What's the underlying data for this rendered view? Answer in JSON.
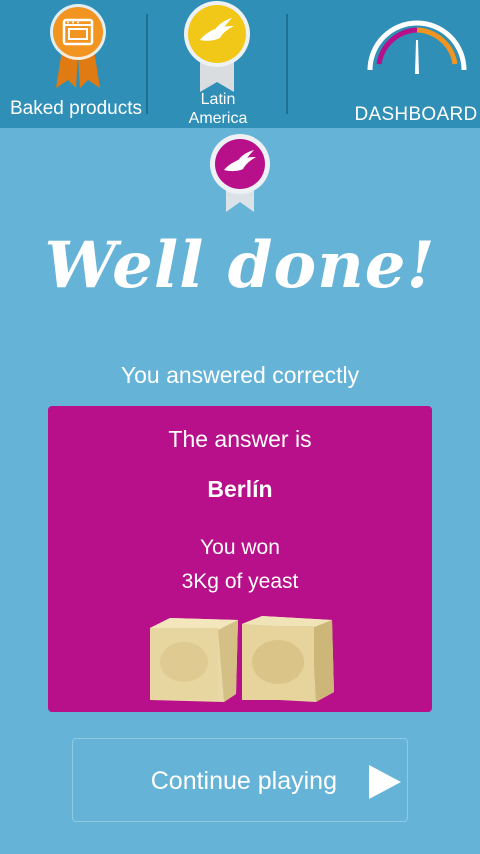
{
  "header": {
    "category": {
      "label": "Baked products",
      "icon": "oven-medal-icon"
    },
    "region": {
      "label_line1": "Latin",
      "label_line2": "America",
      "icon": "swift-gold-medal-icon"
    },
    "dashboard": {
      "label": "DASHBOARD",
      "icon": "gauge-icon"
    }
  },
  "result": {
    "medal_icon": "swift-purple-medal-icon",
    "title": "Well done!",
    "subtitle": "You answered correctly"
  },
  "card": {
    "answer_intro": "The answer is",
    "answer": "Berlín",
    "won": "You won",
    "prize": "3Kg of yeast",
    "image": "yeast-cubes"
  },
  "continue_button": {
    "label": "Continue playing",
    "icon": "play-icon"
  },
  "colors": {
    "background": "#66b3d8",
    "header": "#2f8fb7",
    "card": "#b8108a",
    "medal_orange": "#f19420",
    "medal_gold": "#f2c818",
    "medal_purple": "#b8108a"
  }
}
